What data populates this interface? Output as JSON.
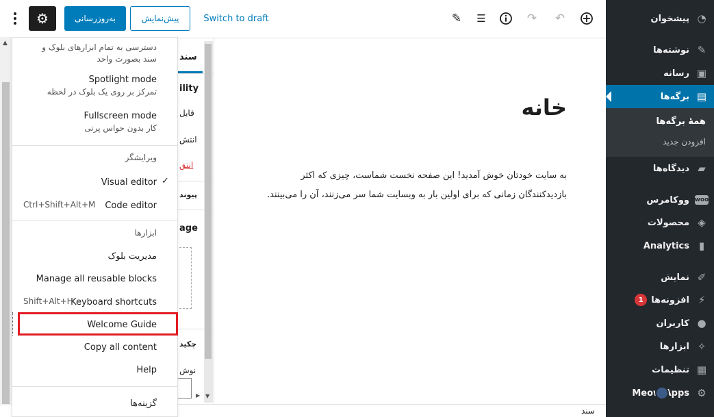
{
  "admin_menu": {
    "items": [
      {
        "label": "پیشخوان",
        "icon": "dashboard-icon",
        "glyph": "◔"
      },
      {
        "label": "نوشته‌ها",
        "icon": "pin-icon",
        "glyph": "✎"
      },
      {
        "label": "رسانه",
        "icon": "media-icon",
        "glyph": "▣"
      },
      {
        "label": "برگه‌ها",
        "icon": "pages-icon",
        "glyph": "▤"
      },
      {
        "label": "دیدگاه‌ها",
        "icon": "comments-icon",
        "glyph": "▰"
      },
      {
        "label": "ووکامرس",
        "icon": "woocommerce-icon",
        "glyph": "woo"
      },
      {
        "label": "محصولات",
        "icon": "products-icon",
        "glyph": "◈"
      },
      {
        "label": "Analytics",
        "icon": "analytics-icon",
        "glyph": "▮"
      },
      {
        "label": "نمایش",
        "icon": "appearance-icon",
        "glyph": "✐"
      },
      {
        "label": "افزونه‌ها",
        "icon": "plugins-icon",
        "glyph": "⚡",
        "badge": "1"
      },
      {
        "label": "کاربران",
        "icon": "users-icon",
        "glyph": "●"
      },
      {
        "label": "ابزارها",
        "icon": "tools-icon",
        "glyph": "✧"
      },
      {
        "label": "تنظیمات",
        "icon": "settings-icon",
        "glyph": "▦"
      },
      {
        "label": "Meow Apps",
        "icon": "meow-gear-icon",
        "glyph": "⚙"
      }
    ],
    "submenu": {
      "current": "همهٔ برگه‌ها",
      "add_new": "افزودن جدید"
    }
  },
  "toolbar": {
    "more_label": "",
    "update_label": "به‌روزرسانی",
    "preview_label": "پیش‌نمایش",
    "draft_label": "Switch to draft"
  },
  "editor": {
    "title": "خانه",
    "body": "به سایت خودتان خوش آمدید! این صفحه نخست شماست، چیزی که اکثر بازدیدکنندگان زمانی که برای اولین بار به وبسایت شما سر می‌زنند، آن را می‌بینند."
  },
  "settings_fragments": {
    "tab": "سند",
    "visibility": "ility",
    "row1": "قابل",
    "row2": "انتش",
    "link": "انتق",
    "section": "پیوند",
    "image": "age",
    "excerpt": "چکید",
    "write": "نوش"
  },
  "dropdown": {
    "top_desc": "دسترسی به تمام ابزارهای بلوک و سند بصورت واحد",
    "spotlight_title": "Spotlight mode",
    "spotlight_desc": "تمرکز بر روی یک بلوک در لحظه",
    "fullscreen_title": "Fullscreen mode",
    "fullscreen_desc": "کار بدون حواس پرتی",
    "editor_group": "ویرایشگر",
    "visual_editor": "Visual editor",
    "code_editor": "Code editor",
    "code_shortcut": "Ctrl+Shift+Alt+M",
    "tools_group": "ابزارها",
    "block_manager": "مدیریت بلوک",
    "reusable_blocks": "Manage all reusable blocks",
    "keyboard_shortcuts": "Keyboard shortcuts",
    "keyboard_shortcut_keys": "Shift+Alt+H",
    "welcome_guide": "Welcome Guide",
    "copy_content": "Copy all content",
    "help": "Help",
    "options": "گزینه‌ها"
  },
  "status_bar": {
    "breadcrumb": "سند"
  },
  "colors": {
    "admin_bg": "#23282d",
    "accent": "#007cba",
    "highlight_box": "#e11b22"
  }
}
